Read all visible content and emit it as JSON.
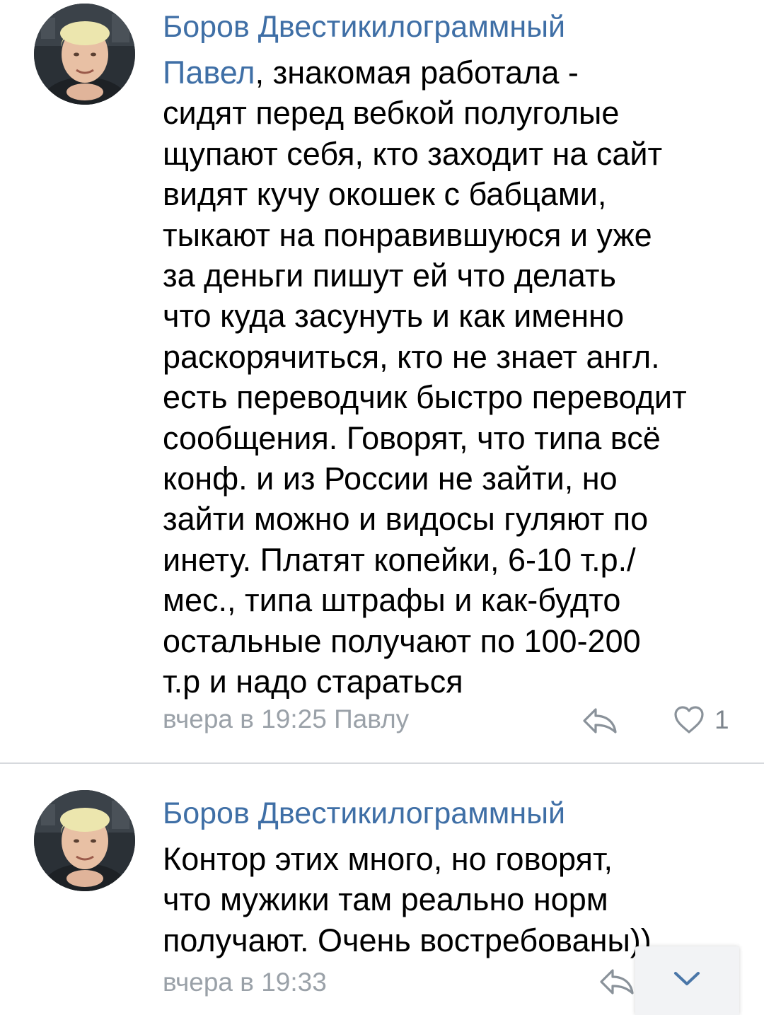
{
  "comments": [
    {
      "author": "Боров Двестикилограммный",
      "mention": "Павел",
      "lines": [
        ", знакомая работала -",
        "сидят перед вебкой полуголые",
        "щупают себя, кто заходит на сайт",
        "видят кучу окошек с бабцами,",
        "тыкают на понравившуюся и уже",
        "за деньги пишут ей что делать",
        "что куда засунуть и как именно",
        "раскорячиться, кто не знает англ.",
        "есть переводчик быстро переводит",
        "сообщения. Говорят, что типа всё",
        "конф. и из России не зайти, но",
        "зайти можно и видосы гуляют по",
        "инету. Платят копейки, 6-10 т.р./",
        "мес., типа штрафы и как-будто",
        "остальные получают по 100-200",
        "т.р и надо стараться"
      ],
      "meta": "вчера в 19:25 Павлу",
      "likes": "1",
      "avatar_icon": "user-avatar-photo"
    },
    {
      "author": "Боров Двестикилограммный",
      "lines": [
        "Контор этих много, но говорят,",
        "что мужики там реально норм",
        "получают. Очень востребованы))"
      ],
      "meta": "вчера в 19:33",
      "avatar_icon": "user-avatar-photo"
    }
  ],
  "icons": {
    "reply": "reply-arrow-icon",
    "like": "heart-outline-icon",
    "scroll": "chevron-down-icon"
  },
  "colors": {
    "link": "#3f6fa6",
    "meta": "#9aa1a8",
    "divider": "#d6d9dd"
  }
}
